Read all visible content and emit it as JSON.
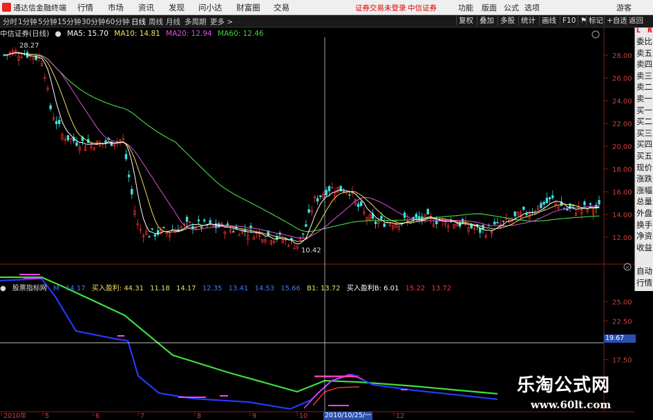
{
  "app": {
    "title": "通达信金融终端"
  },
  "menu": [
    "行情",
    "市场",
    "资讯",
    "发现",
    "问小达",
    "财富圈",
    "交易"
  ],
  "notice": {
    "left": "证券交易未登录",
    "right": "中信证券"
  },
  "window_buttons": [
    "功能",
    "版面",
    "公式",
    "选项",
    "游客"
  ],
  "toolbar": {
    "periods": [
      "分时",
      "1分钟",
      "5分钟",
      "15分钟",
      "30分钟",
      "60分钟",
      "日线",
      "周线",
      "月线",
      "多周期",
      "更多 >"
    ],
    "active": "日线",
    "right": [
      "复权",
      "叠加",
      "多股",
      "统计",
      "画线",
      "F10",
      "标记",
      "+自选",
      "返回"
    ]
  },
  "stock": {
    "name": "中信证券(日线)"
  },
  "ma": [
    {
      "label": "MA5: 15.70",
      "color": "#ffffff"
    },
    {
      "label": "MA10: 14.81",
      "color": "#f0e060"
    },
    {
      "label": "MA20: 12.94",
      "color": "#e050e0"
    },
    {
      "label": "MA60: 12.46",
      "color": "#40d040"
    }
  ],
  "price_axis": [
    "28.00",
    "26.00",
    "24.00",
    "22.00",
    "20.00",
    "18.00",
    "16.00",
    "14.00",
    "12.00"
  ],
  "annotations": {
    "high": "28.27",
    "low": "10.42"
  },
  "indicator": {
    "name": "股票指标网",
    "values": [
      {
        "label": "14.17",
        "color": "#3a7bff"
      },
      {
        "label": "买入盈利: 44.31",
        "color": "#f0e060"
      },
      {
        "label": "11.18",
        "color": "#f0e060"
      },
      {
        "label": "14.17",
        "color": "#f0e060"
      },
      {
        "label": "12.35",
        "color": "#3a7bff"
      },
      {
        "label": "13.41",
        "color": "#3a7bff"
      },
      {
        "label": "14.53",
        "color": "#3a7bff"
      },
      {
        "label": "15.66",
        "color": "#3a7bff"
      },
      {
        "label": "B1: 13.72",
        "color": "#f0e060"
      },
      {
        "label": "买入盈利B: 6.01",
        "color": "#ffffff"
      },
      {
        "label": "15.22",
        "color": "#ff3030"
      },
      {
        "label": "13.72",
        "color": "#ff3030"
      }
    ],
    "axis": [
      "25.00",
      "22.50",
      "17.50"
    ],
    "current": "19.67"
  },
  "side_panel": [
    "委比",
    "卖五",
    "卖四",
    "卖三",
    "卖二",
    "卖一",
    "买一",
    "买二",
    "买三",
    "买四",
    "买五",
    "现价",
    "涨跌",
    "涨幅",
    "总量",
    "外盘",
    "换手",
    "净资",
    "收益"
  ],
  "side_panel2": [
    "自动",
    "行情"
  ],
  "side_corner": {
    "left": "L",
    "right": "R"
  },
  "x_axis": [
    "2010年",
    "5",
    "6",
    "7",
    "8",
    "9",
    "10",
    "12"
  ],
  "crosshair_date": "2010/10/25/一",
  "watermark": {
    "cn": "乐淘公式网",
    "url": "www.60lt.com"
  }
}
